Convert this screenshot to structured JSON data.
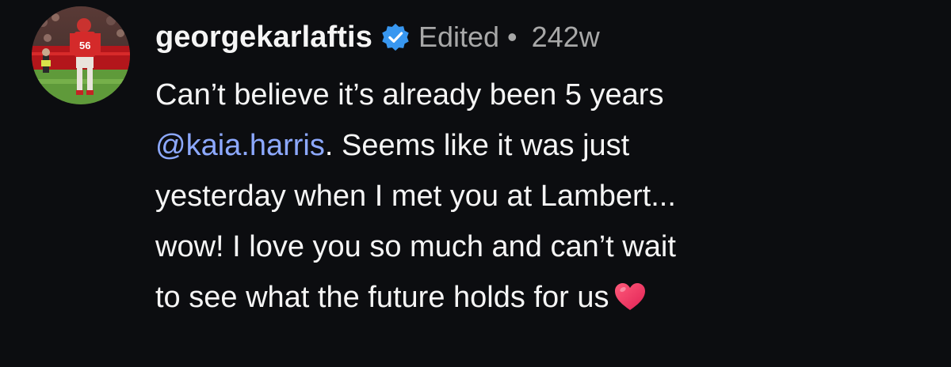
{
  "post": {
    "username": "georgekarlaftis",
    "verified_icon": "verified-badge-icon",
    "edited_label": "Edited",
    "separator": "•",
    "timestamp": "242w",
    "caption": {
      "line1": "Can’t believe it’s already been 5 years",
      "mention": "@kaia.harris",
      "line2_rest": ". Seems like it was just",
      "line3": "yesterday when I met you at Lambert...",
      "line4": "wow! I love you so much and can’t wait",
      "line5": "to see what the future holds for us"
    },
    "emoji_icon": "heart-icon"
  },
  "colors": {
    "background": "#0c0d10",
    "text": "#f5f5f5",
    "muted": "#a8a8a8",
    "mention": "#8da9ff",
    "verified": "#3897f0",
    "heart": "#ff3d71"
  }
}
